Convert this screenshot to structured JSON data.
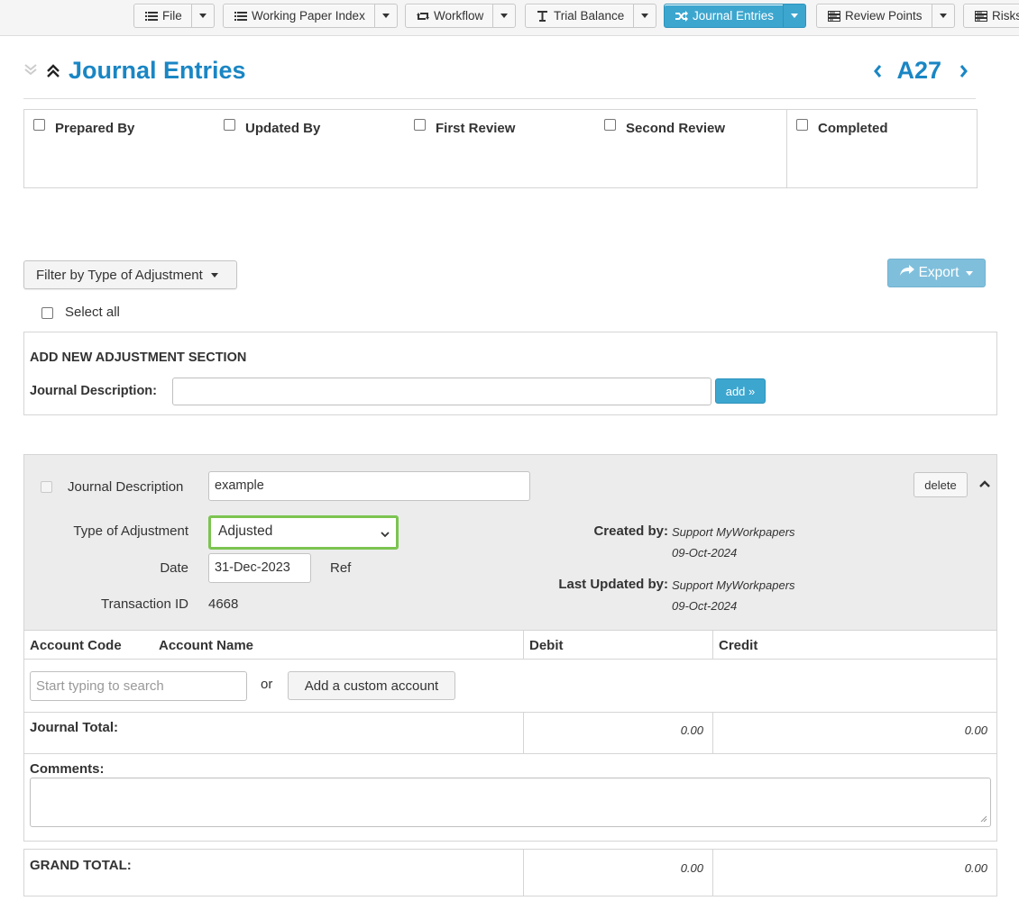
{
  "toolbar": {
    "file": "File",
    "working_paper_index": "Working Paper Index",
    "workflow": "Workflow",
    "trial_balance": "Trial Balance",
    "journal_entries": "Journal Entries",
    "review_points": "Review Points",
    "risks": "Risks",
    "active_color": "#3ca6cf"
  },
  "header": {
    "title": "Journal Entries",
    "ref": "A27"
  },
  "signoff": {
    "prepared_by": "Prepared By",
    "updated_by": "Updated By",
    "first_review": "First Review",
    "second_review": "Second Review",
    "completed": "Completed"
  },
  "filter": {
    "label": "Filter by Type of Adjustment"
  },
  "export": {
    "label": "Export"
  },
  "select_all": "Select all",
  "add_section": {
    "title": "ADD NEW ADJUSTMENT SECTION",
    "description_label": "Journal Description:",
    "description_value": "",
    "add_button": "add »"
  },
  "journal": {
    "description_label": "Journal Description",
    "description_value": "example",
    "type_label": "Type of Adjustment",
    "type_value": "Adjusted",
    "date_label": "Date",
    "date_value": "31-Dec-2023",
    "ref_label": "Ref",
    "transaction_id_label": "Transaction ID",
    "transaction_id_value": "4668",
    "delete_button": "delete",
    "created_by_label": "Created by:",
    "created_by_name": "Support MyWorkpapers",
    "created_by_date": "09-Oct-2024",
    "updated_by_label": "Last Updated by:",
    "updated_by_name": "Support MyWorkpapers",
    "updated_by_date": "09-Oct-2024",
    "columns": {
      "account_code": "Account Code",
      "account_name": "Account Name",
      "debit": "Debit",
      "credit": "Credit"
    },
    "search_placeholder": "Start typing to search",
    "or_text": "or",
    "custom_account_button": "Add a custom account",
    "total_label": "Journal Total:",
    "total_debit": "0.00",
    "total_credit": "0.00",
    "comments_label": "Comments:",
    "comments_value": "",
    "focus_color": "#7cc450"
  },
  "grand_total": {
    "label": "GRAND TOTAL:",
    "debit": "0.00",
    "credit": "0.00"
  }
}
